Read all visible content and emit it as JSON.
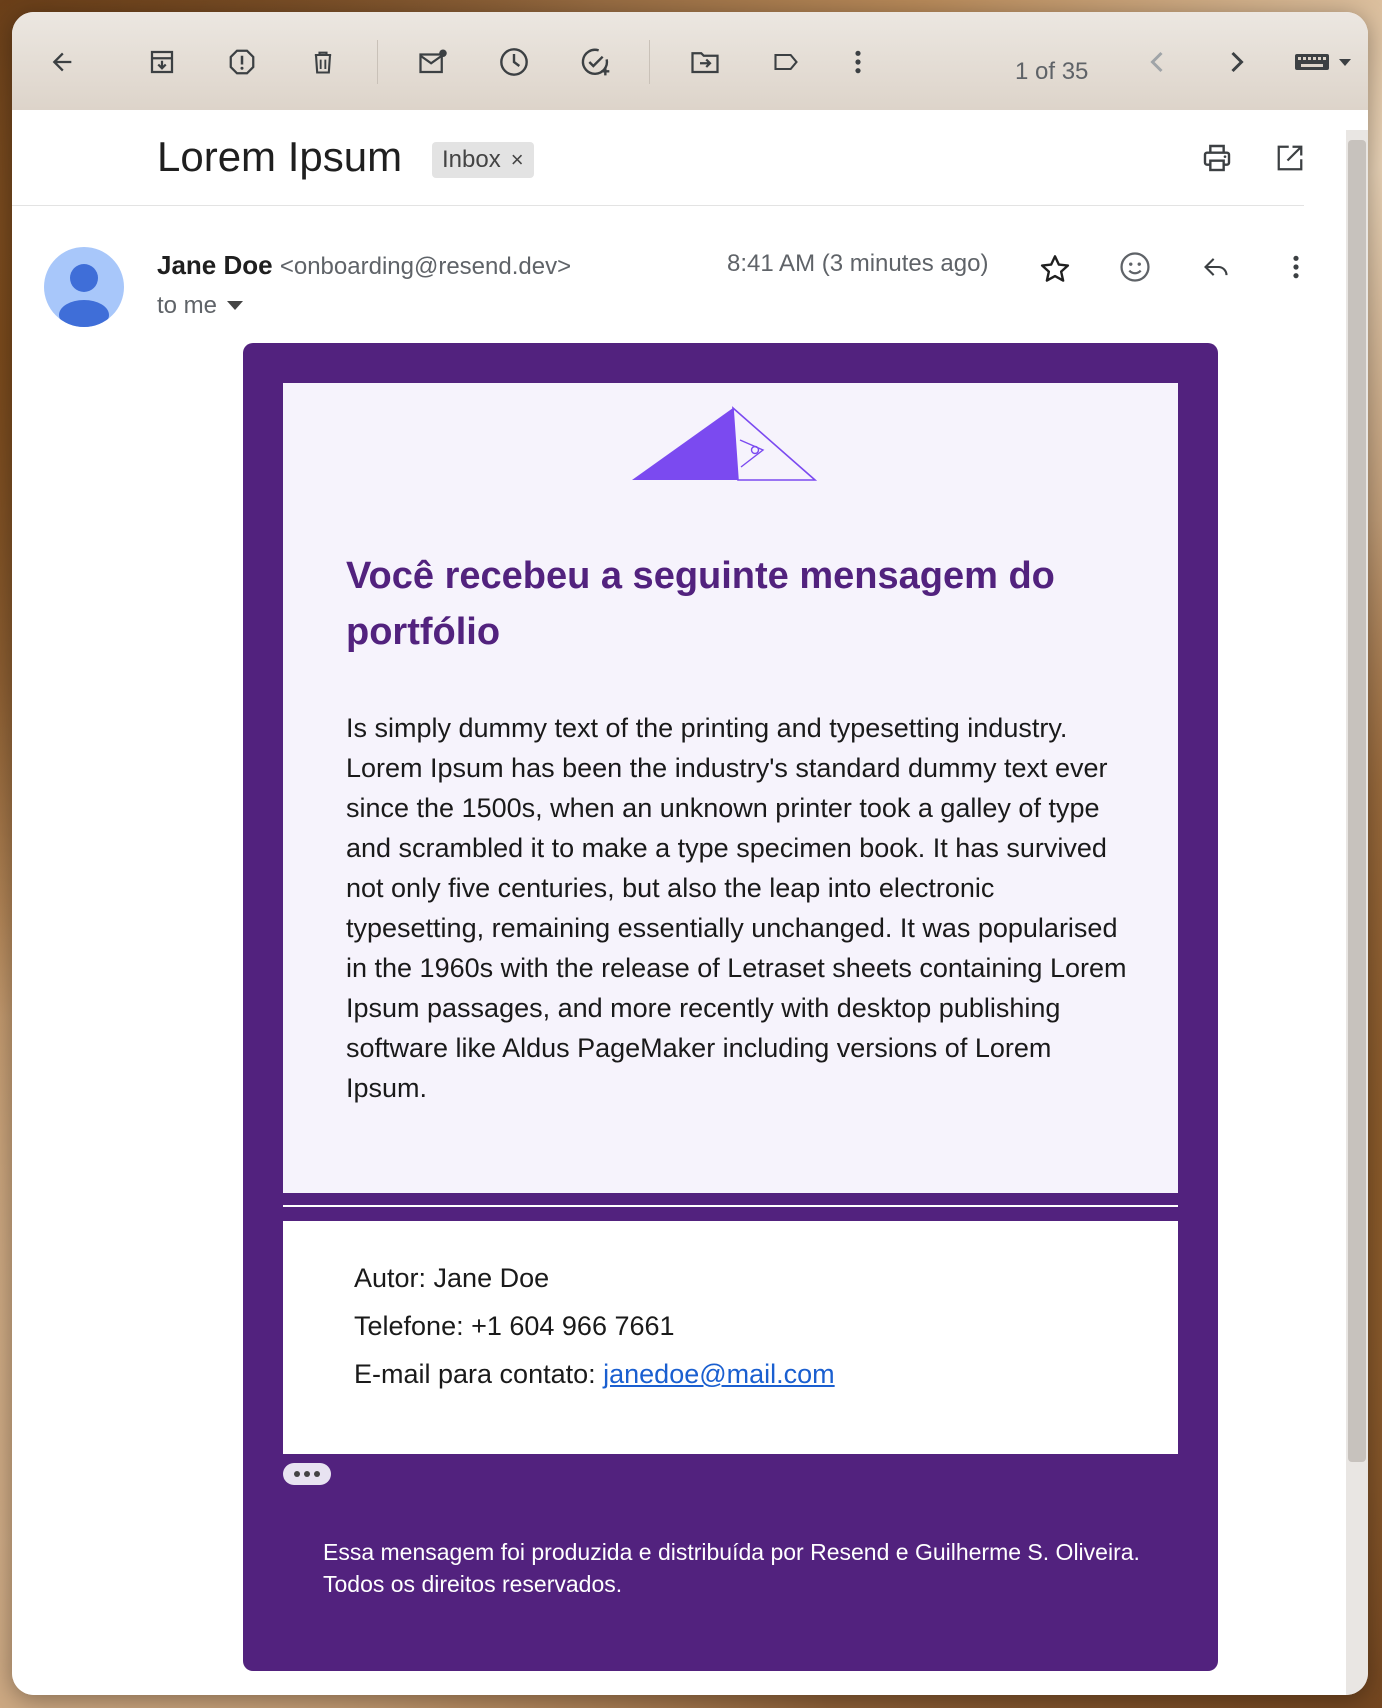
{
  "toolbar": {
    "counter": "1 of 35",
    "icons": [
      "back-arrow-icon",
      "archive-icon",
      "report-spam-icon",
      "delete-icon",
      "mark-unread-icon",
      "snooze-icon",
      "add-task-icon",
      "move-to-icon",
      "label-icon",
      "more-vert-icon",
      "prev-icon",
      "next-icon",
      "keyboard-icon"
    ]
  },
  "subject": {
    "title": "Lorem Ipsum",
    "label_chip": "Inbox",
    "chip_close": "×"
  },
  "message": {
    "sender_name": "Jane Doe",
    "sender_email": "<onboarding@resend.dev>",
    "recipient": "to me",
    "time": "8:41 AM (3 minutes ago)"
  },
  "email_body": {
    "heading": "Você recebeu a seguinte mensagem do portfólio",
    "text": "Is simply dummy text of the printing and typesetting industry. Lorem Ipsum has been the industry's standard dummy text ever since the 1500s, when an unknown printer took a galley of type and scrambled it to make a type specimen book. It has survived not only five centuries, but also the leap into electronic typesetting, remaining essentially unchanged. It was popularised in the 1960s with the release of Letraset sheets containing Lorem Ipsum passages, and more recently with desktop publishing software like Aldus PageMaker including versions of Lorem Ipsum.",
    "author_label": "Autor: Jane Doe",
    "phone_label": "Telefone: +1 604 966 7661",
    "email_label": "E-mail para contato: ",
    "email_link": "janedoe@mail.com",
    "footer": "Essa mensagem foi produzida e distribuída por Resend e Guilherme S. Oliveira. Todos os direitos reservados."
  },
  "colors": {
    "brand_purple": "#52227e",
    "logo_purple": "#7b4af0",
    "card_bg": "#f6f3fc",
    "link": "#1a5fd0"
  }
}
